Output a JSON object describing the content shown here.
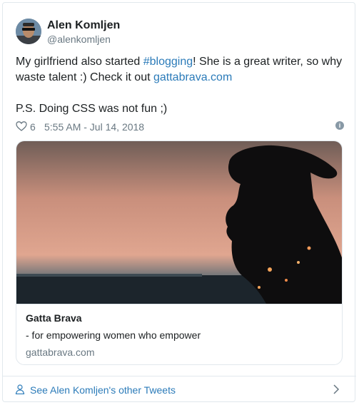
{
  "author": {
    "name": "Alen Komljen",
    "handle": "@alenkomljen"
  },
  "tweet": {
    "text_before": "My girlfriend also started ",
    "hashtag": "#blogging",
    "text_middle": "! She is a great writer, so why waste talent :) Check it out ",
    "link": "gattabrava.com",
    "ps": "P.S. Doing CSS was not fun ;)"
  },
  "meta": {
    "likes": "6",
    "timestamp": "5:55 AM - Jul 14, 2018",
    "info_icon": "info-icon"
  },
  "card": {
    "title": "Gatta Brava",
    "description": "- for empowering women who empower",
    "domain": "gattabrava.com"
  },
  "footer": {
    "more_tweets": "See Alen Komljen's other Tweets"
  },
  "colors": {
    "link": "#2b7bb9",
    "muted": "#697882",
    "border": "#e1e8ed"
  }
}
